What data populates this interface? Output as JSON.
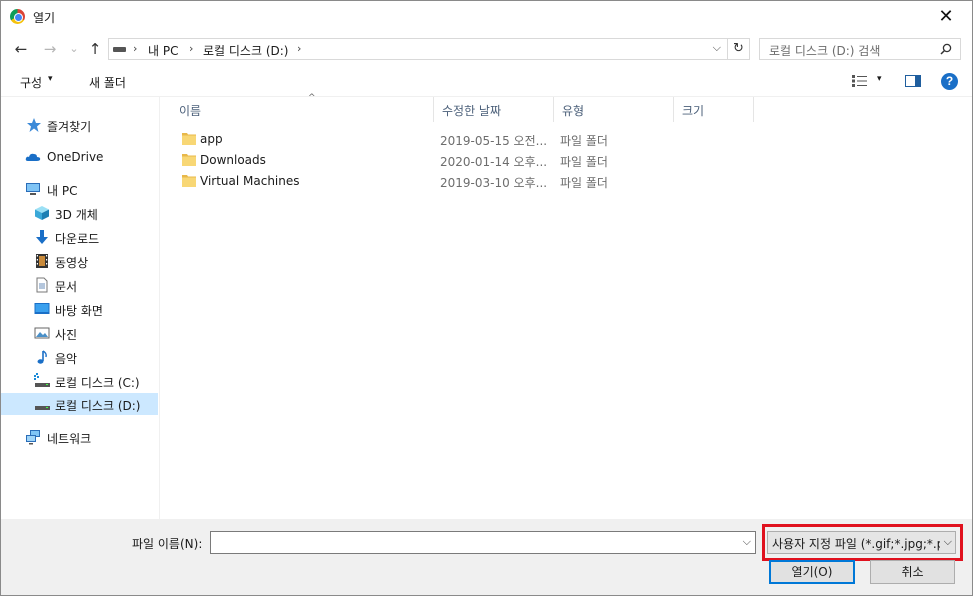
{
  "window": {
    "title": "열기",
    "close_glyph": "✕"
  },
  "nav": {
    "back": "←",
    "forward": "→",
    "recent": "⌄",
    "up": "↑"
  },
  "address": {
    "breadcrumbs": [
      "내 PC",
      "로컬 디스크 (D:)"
    ],
    "separator": "›",
    "dropdown": "⌵",
    "refresh": "↻"
  },
  "search": {
    "placeholder": "로컬 디스크 (D:) 검색",
    "icon": "search-icon"
  },
  "toolbar": {
    "organize": "구성",
    "new_folder": "새 폴더",
    "caret": "▾",
    "help": "?"
  },
  "sidebar": {
    "items": [
      {
        "label": "즐겨찾기",
        "icon": "star-icon"
      },
      {
        "label": "OneDrive",
        "icon": "cloud-icon"
      },
      {
        "label": "내 PC",
        "icon": "computer-icon"
      },
      {
        "label": "3D 개체",
        "icon": "cube-icon"
      },
      {
        "label": "다운로드",
        "icon": "download-icon"
      },
      {
        "label": "동영상",
        "icon": "video-icon"
      },
      {
        "label": "문서",
        "icon": "document-icon"
      },
      {
        "label": "바탕 화면",
        "icon": "desktop-icon"
      },
      {
        "label": "사진",
        "icon": "picture-icon"
      },
      {
        "label": "음악",
        "icon": "music-icon"
      },
      {
        "label": "로컬 디스크 (C:)",
        "icon": "drive-c-icon"
      },
      {
        "label": "로컬 디스크 (D:)",
        "icon": "drive-d-icon",
        "selected": true
      },
      {
        "label": "네트워크",
        "icon": "network-icon"
      }
    ]
  },
  "columns": [
    "이름",
    "수정한 날짜",
    "유형",
    "크기"
  ],
  "sort_glyph": "^",
  "files": [
    {
      "name": "app",
      "modified": "2019-05-15 오전...",
      "type": "파일 폴더",
      "size": ""
    },
    {
      "name": "Downloads",
      "modified": "2020-01-14 오후...",
      "type": "파일 폴더",
      "size": ""
    },
    {
      "name": "Virtual Machines",
      "modified": "2019-03-10 오후...",
      "type": "파일 폴더",
      "size": ""
    }
  ],
  "footer": {
    "filename_label": "파일 이름(N):",
    "filename_value": "",
    "filter_value": "사용자 지정 파일 (*.gif;*.jpg;*.p",
    "open_button": "열기(O)",
    "cancel_button": "취소",
    "dd_glyph": "⌵"
  },
  "colors": {
    "accent": "#0078d7",
    "highlight_box": "#e0111e",
    "selected_bg": "#cce8ff",
    "folder": "#f8d775"
  }
}
